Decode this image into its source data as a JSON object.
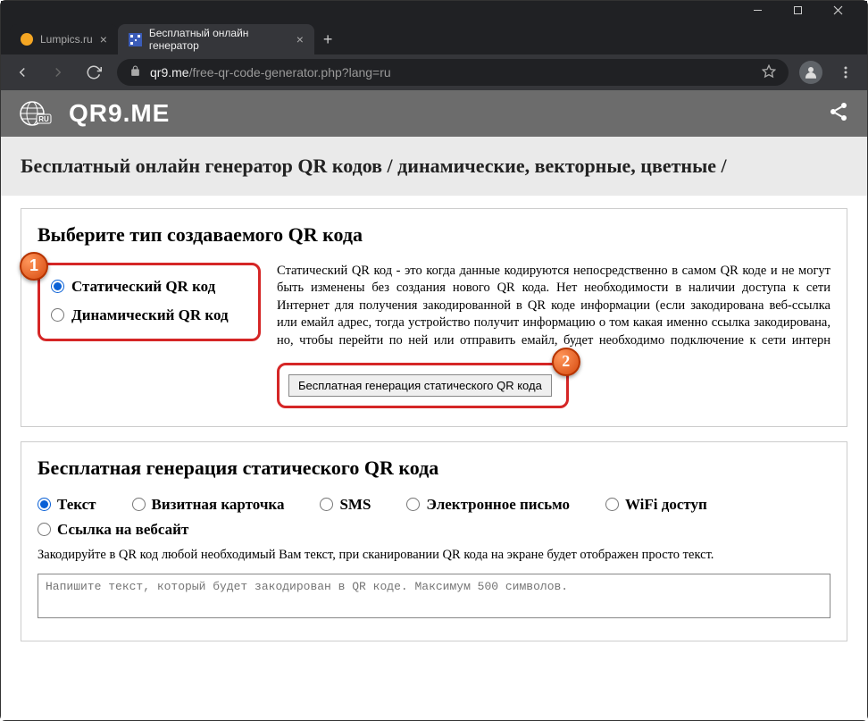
{
  "browser": {
    "tabs": [
      {
        "title": "Lumpics.ru",
        "active": false
      },
      {
        "title": "Бесплатный онлайн генератор",
        "active": true
      }
    ],
    "url_domain": "qr9.me",
    "url_path": "/free-qr-code-generator.php?lang=ru"
  },
  "header": {
    "lang": "RU",
    "title": "QR9.ME"
  },
  "subheader": "Бесплатный онлайн генератор QR кодов / динамические, векторные, цветные /",
  "type_select": {
    "legend": "Выберите тип создаваемого QR кода",
    "options": {
      "static": "Статический QR код",
      "dynamic": "Динамический QR код"
    },
    "description": "Статический QR код - это когда данные кодируются непосредственно в самом QR коде и не могут быть изменены без создания нового QR кода. Нет необходимости в наличии доступа к сети Интернет для получения закодированной в QR коде информации (если закодирована веб-ссылка или емайл адрес, тогда устройство получит информацию о том какая именно ссылка закодирована, но, чтобы перейти по ней или отправить емайл, будет необходимо подключение к сети интерн",
    "button": "Бесплатная генерация статического QR кода"
  },
  "static_gen": {
    "legend": "Бесплатная генерация статического QR кода",
    "formats": {
      "text": "Текст",
      "vcard": "Визитная карточка",
      "sms": "SMS",
      "email": "Электронное письмо",
      "wifi": "WiFi доступ",
      "url": "Ссылка на вебсайт"
    },
    "help": "Закодируйте в QR код любой необходимый Вам текст, при сканировании QR кода на экране будет отображен просто текст.",
    "placeholder": "Напишите текст, который будет закодирован в QR коде. Максимум 500 символов."
  },
  "annotations": {
    "one": "1",
    "two": "2"
  }
}
